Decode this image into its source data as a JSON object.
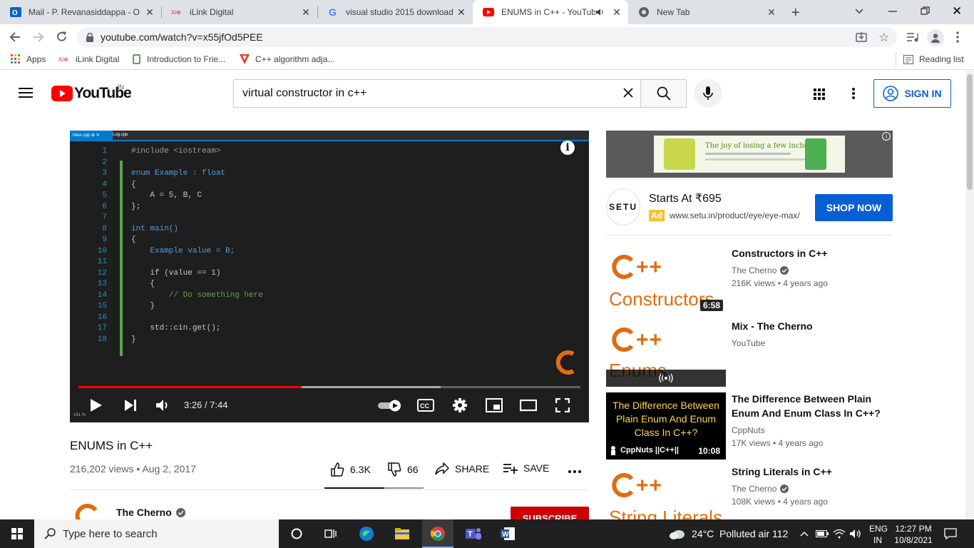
{
  "browser": {
    "tabs": [
      {
        "label": "Mail - P. Revanasiddappa - O",
        "icon": "outlook-icon"
      },
      {
        "label": "iLink Digital",
        "icon": "ilink-icon"
      },
      {
        "label": "visual studio 2015 download",
        "icon": "google-icon"
      },
      {
        "label": "ENUMS in C++ - YouTub",
        "icon": "youtube-icon",
        "active": true
      },
      {
        "label": "New Tab",
        "icon": "chrome-icon"
      }
    ],
    "url": "youtube.com/watch?v=x55jfOd5PEE",
    "bookmarks": [
      {
        "label": "Apps",
        "icon": "apps-grid-icon"
      },
      {
        "label": "iLink Digital",
        "icon": "ilink-icon"
      },
      {
        "label": "Introduction to Frie...",
        "icon": "bookmark-page-icon"
      },
      {
        "label": "C++ algorithm adja...",
        "icon": "bookmark-v-icon"
      }
    ],
    "reading_list": "Reading list"
  },
  "youtube": {
    "logo_text": "YouTube",
    "country": "IN",
    "search_value": "virtual constructor in c++",
    "sign_in": "SIGN IN"
  },
  "player": {
    "editor_tabs": [
      "Main.cpp",
      "Log.cpp"
    ],
    "code_lines": [
      {
        "num": "1",
        "text": "#include <iostream>"
      },
      {
        "num": "2",
        "text": ""
      },
      {
        "num": "3",
        "text": "enum Example : float"
      },
      {
        "num": "4",
        "text": "{"
      },
      {
        "num": "5",
        "text": "    A = 5, B, C"
      },
      {
        "num": "6",
        "text": "};"
      },
      {
        "num": "7",
        "text": ""
      },
      {
        "num": "8",
        "text": "int main()"
      },
      {
        "num": "9",
        "text": "{"
      },
      {
        "num": "10",
        "text": "    Example value = B;"
      },
      {
        "num": "11",
        "text": ""
      },
      {
        "num": "12",
        "text": "    if (value == 1)"
      },
      {
        "num": "13",
        "text": "    {"
      },
      {
        "num": "14",
        "text": "        // Do something here"
      },
      {
        "num": "15",
        "text": "    }"
      },
      {
        "num": "16",
        "text": ""
      },
      {
        "num": "17",
        "text": "    std::cin.get();"
      },
      {
        "num": "18",
        "text": "}"
      }
    ],
    "zoom": "161 %",
    "time": "3:26 / 7:44",
    "progress": 0.444
  },
  "video": {
    "title": "ENUMS in C++",
    "meta": "216,202 views • Aug 2, 2017",
    "likes": "6.3K",
    "dislikes": "66",
    "share": "SHARE",
    "save": "SAVE",
    "channel": "The Cherno",
    "subscribe": "SUBSCRIBE"
  },
  "ad": {
    "banner_text": "The joy of losing a few inches",
    "logo": "SETU",
    "title": "Starts At ₹695",
    "badge": "Ad",
    "url": "www.setu.in/product/eye/eye-max/",
    "cta": "SHOP NOW"
  },
  "recommendations": [
    {
      "title": "Constructors in C++",
      "channel": "The Cherno",
      "verified": true,
      "meta": "216K views • 4 years ago",
      "duration": "6:58",
      "thumb_word": "Constructors"
    },
    {
      "title": "Mix - The Cherno",
      "channel": "YouTube",
      "verified": false,
      "meta": "",
      "duration": "",
      "thumb_word": "Enums"
    },
    {
      "title": "The Difference Between Plain Enum And Enum Class In C++?",
      "channel": "CppNuts",
      "verified": false,
      "meta": "17K views • 4 years ago",
      "duration": "10:08",
      "thumb_text": "The Difference Between Plain Enum And Enum Class In C++?",
      "thumb_brand": "CppNuts ||C++||"
    },
    {
      "title": "String Literals in C++",
      "channel": "The Cherno",
      "verified": true,
      "meta": "108K views • 4 years ago",
      "duration": "",
      "thumb_word": "String Literals"
    }
  ],
  "taskbar": {
    "search_placeholder": "Type here to search",
    "weather": "24°C  Polluted air 112",
    "lang_top": "ENG",
    "lang_bottom": "IN",
    "time": "12:27 PM",
    "date": "10/8/2021"
  },
  "colors": {
    "youtube_red": "#ff0000",
    "link_blue": "#065fd4",
    "cpp_orange": "#e06d10"
  }
}
